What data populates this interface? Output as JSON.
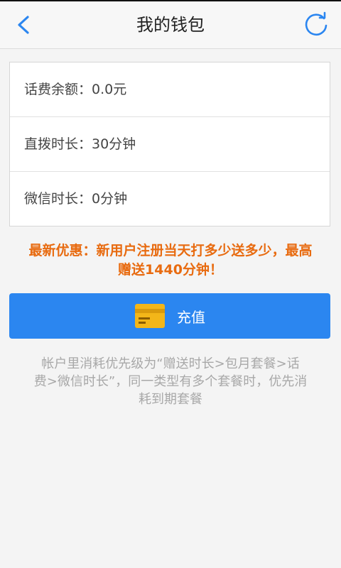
{
  "header": {
    "title": "我的钱包",
    "back_icon": "chevron-left-icon",
    "refresh_icon": "refresh-icon"
  },
  "account": {
    "items": [
      {
        "label": "话费余额：0.0元"
      },
      {
        "label": "直拨时长：30分钟"
      },
      {
        "label": "微信时长：0分钟"
      }
    ]
  },
  "promo": {
    "line1": "最新优惠：新用户注册当天打多少送多少，最高",
    "line2": "赠送1440分钟！"
  },
  "recharge": {
    "label": "充值",
    "icon": "card-icon"
  },
  "note": {
    "line1": "帐户里消耗优先级为“赠送时长>包月套餐>话",
    "line2": "费>微信时长”，同一类型有多个套餐时，优先消",
    "line3": "耗到期套餐"
  },
  "colors": {
    "accent": "#2b86f0",
    "promo": "#e86b10",
    "card_icon": "#f3b619"
  }
}
